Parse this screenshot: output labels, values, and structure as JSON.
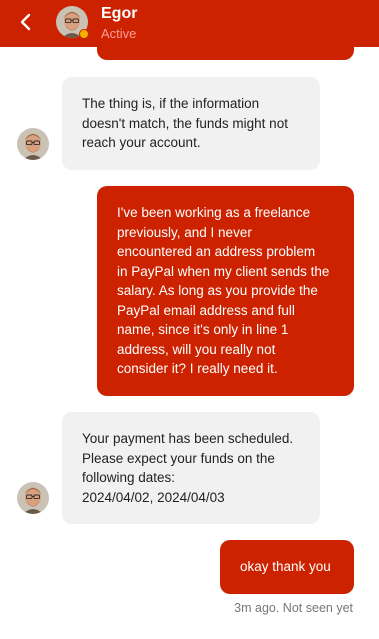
{
  "header": {
    "contact_name": "Egor",
    "contact_status": "Active",
    "colors": {
      "brand": "#cc2200",
      "status_dot": "#f5b301"
    },
    "icons": {
      "back": "chevron-left-icon"
    }
  },
  "messages": [
    {
      "from": "agent",
      "text": "The thing is, if the information\ndoesn't match, the funds might not\nreach your account."
    },
    {
      "from": "user",
      "text": "I've been working as a freelance\npreviously, and I never\nencountered an address problem\nin PayPal when my client sends the\nsalary. As long as you provide the\nPayPal email address and full\nname, since it's only in line 1\naddress, will you really not\nconsider it? I really need it."
    },
    {
      "from": "agent",
      "text": "Your payment has been scheduled.\nPlease expect your funds on the\nfollowing dates:\n2024/04/02, 2024/04/03"
    },
    {
      "from": "user",
      "text": "okay thank you"
    }
  ],
  "read_receipt": "3m ago. Not seen yet"
}
